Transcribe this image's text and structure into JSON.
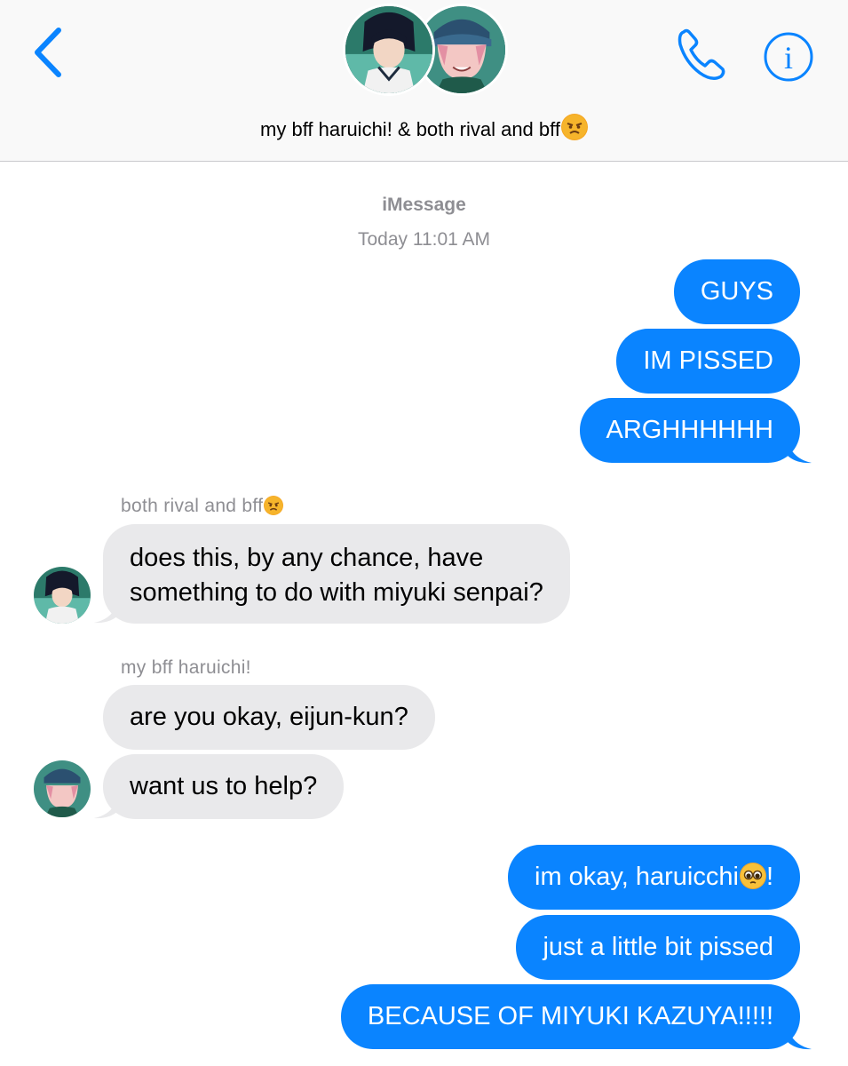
{
  "header": {
    "title": "my bff haruichi! & both rival and bff",
    "title_emoji": "angry-face-emoji",
    "back_icon": "chevron-left-icon",
    "call_icon": "phone-icon",
    "info_icon": "info-icon",
    "accent": "#0a84ff"
  },
  "thread": {
    "service": "iMessage",
    "timestamp": "Today 11:01 AM"
  },
  "messages": [
    {
      "from": "me",
      "text": "GUYS"
    },
    {
      "from": "me",
      "text": "IM PISSED"
    },
    {
      "from": "me",
      "text": "ARGHHHHHH"
    },
    {
      "from": "both rival and bff",
      "sender_label": "both rival and bff",
      "lines": [
        "does this, by any chance, have",
        "something to do with miyuki senpai?"
      ]
    },
    {
      "from": "my bff haruichi!",
      "sender_label": "my bff haruichi!",
      "text": "are you okay, eijun-kun?"
    },
    {
      "from": "my bff haruichi!",
      "text": "want us to help?"
    },
    {
      "from": "me",
      "text": "im okay, haruicchi",
      "suffix": "!",
      "emoji": "pleading-face-emoji"
    },
    {
      "from": "me",
      "text": "just a little bit pissed"
    },
    {
      "from": "me",
      "text": "BECAUSE OF MIYUKI KAZUYA!!!!!"
    }
  ],
  "colors": {
    "outgoing": "#0a84ff",
    "incoming": "#e9e9eb",
    "meta_text": "#8e8e93"
  }
}
